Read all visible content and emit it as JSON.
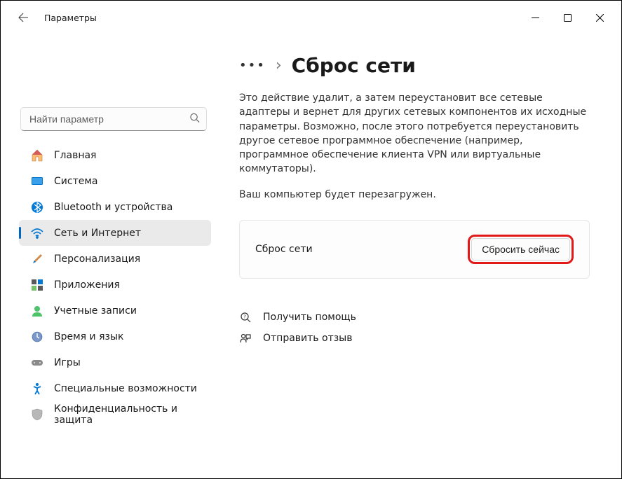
{
  "app": {
    "title": "Параметры"
  },
  "search": {
    "placeholder": "Найти параметр"
  },
  "sidebar": {
    "items": [
      {
        "label": "Главная"
      },
      {
        "label": "Система"
      },
      {
        "label": "Bluetooth и устройства"
      },
      {
        "label": "Сеть и Интернет"
      },
      {
        "label": "Персонализация"
      },
      {
        "label": "Приложения"
      },
      {
        "label": "Учетные записи"
      },
      {
        "label": "Время и язык"
      },
      {
        "label": "Игры"
      },
      {
        "label": "Специальные возможности"
      },
      {
        "label": "Конфиденциальность и защита"
      }
    ]
  },
  "main": {
    "breadcrumb_ellipsis": "•••",
    "title": "Сброс сети",
    "description": "Это действие удалит, а затем переустановит все сетевые адаптеры и вернет для других сетевых компонентов их исходные параметры. Возможно, после этого потребуется переустановить другое сетевое программное обеспечение (например, программное обеспечение клиента VPN или виртуальные коммутаторы).",
    "subtext": "Ваш компьютер будет перезагружен.",
    "card_label": "Сброс сети",
    "reset_button": "Сбросить сейчас",
    "help_link": "Получить помощь",
    "feedback_link": "Отправить отзыв"
  }
}
